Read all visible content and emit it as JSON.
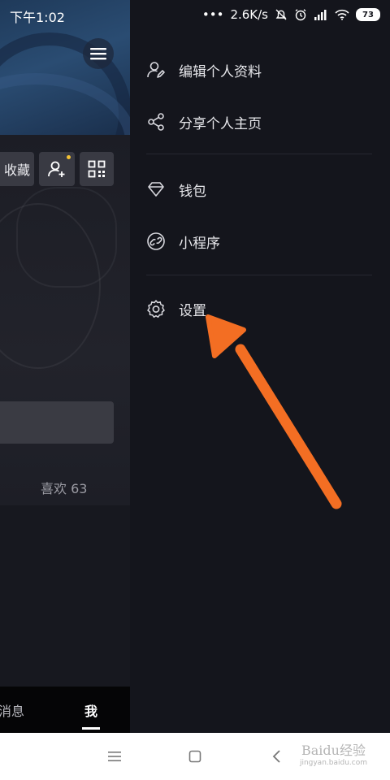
{
  "status_bar": {
    "time": "下午1:02",
    "dots": "•••",
    "speed": "2.6K/s",
    "battery": "73"
  },
  "profile": {
    "collect_label": "收藏",
    "likes_label": "喜欢 63"
  },
  "bottom_nav": {
    "messages": "消息",
    "me": "我"
  },
  "drawer": {
    "items": [
      {
        "label": "编辑个人资料",
        "icon": "edit-profile-icon"
      },
      {
        "label": "分享个人主页",
        "icon": "share-icon"
      },
      {
        "label": "钱包",
        "icon": "diamond-wallet-icon"
      },
      {
        "label": "小程序",
        "icon": "link-mini-program-icon"
      },
      {
        "label": "设置",
        "icon": "gear-icon"
      }
    ]
  },
  "annotation": {
    "color": "#f36e23"
  },
  "watermark": {
    "line1": "Baidu经验",
    "line2": "jingyan.baidu.com"
  }
}
